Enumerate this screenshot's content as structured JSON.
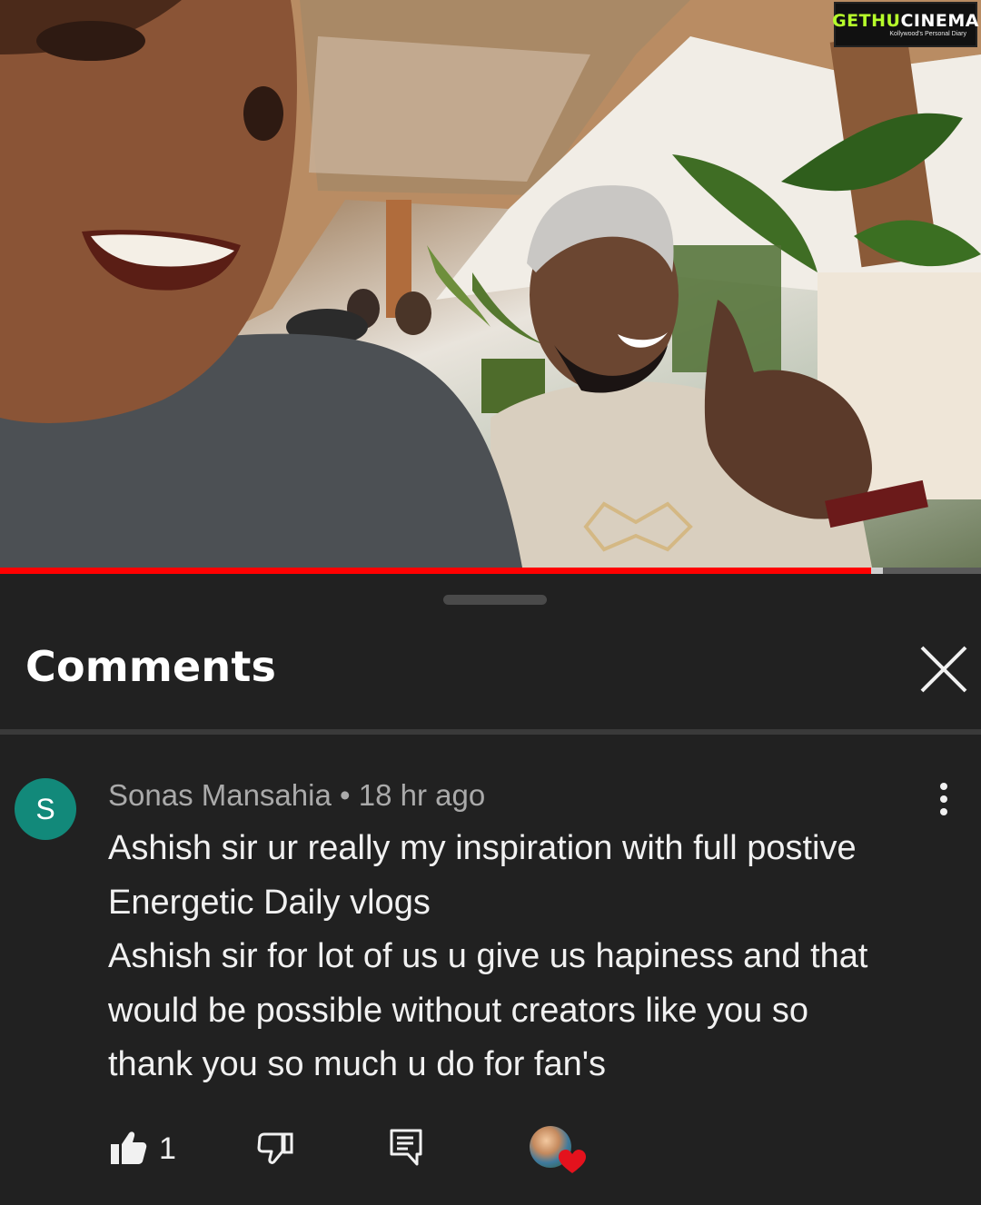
{
  "watermark": {
    "brand_main": "GETHU",
    "brand_accent": "CINEMA",
    "tagline": "Kollywood's Personal Diary"
  },
  "video": {
    "progress_fraction": 0.888,
    "buffer_fraction": 0.9,
    "colors": {
      "progress": "#ff0000",
      "track": "#5a5a5a",
      "buffer": "#cfcfcf"
    }
  },
  "comments_sheet": {
    "title": "Comments",
    "close_icon": "close-icon"
  },
  "comment": {
    "avatar_letter": "S",
    "avatar_color": "#12897a",
    "author": "Sonas Mansahia",
    "separator": "•",
    "time": "18 hr ago",
    "lines": [
      "Ashish sir ur really my inspiration with full postive",
      "Energetic Daily vlogs",
      "Ashish sir for lot of us u give us hapiness and that",
      "would be possible without creators like you so",
      "thank you so much u do for fan's"
    ],
    "like_count": "1",
    "actions": {
      "like_icon": "thumbs-up-icon",
      "dislike_icon": "thumbs-down-icon",
      "reply_icon": "reply-icon",
      "creator_heart_icon": "creator-heart-icon",
      "more_icon": "more-vertical-icon"
    }
  }
}
